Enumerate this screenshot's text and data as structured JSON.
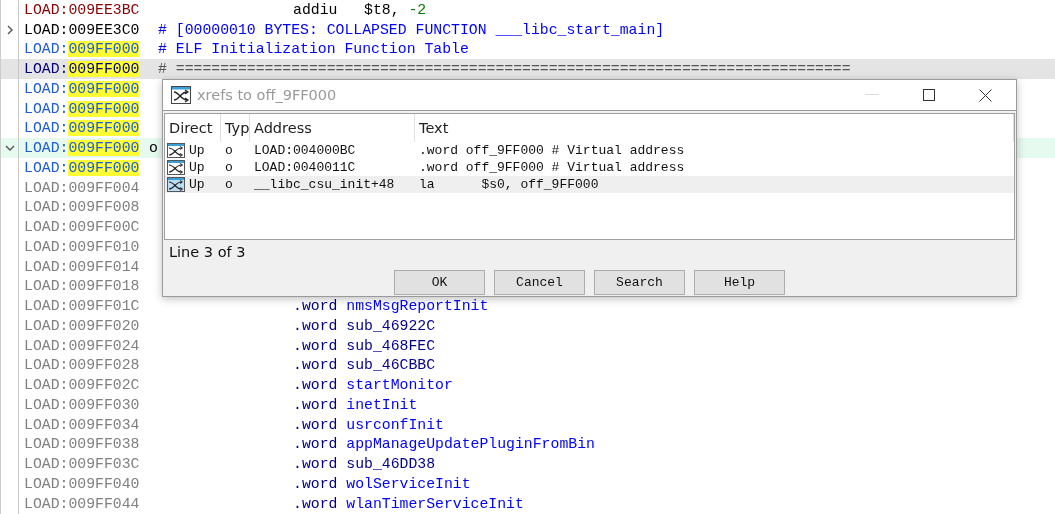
{
  "listing": {
    "rows": [
      {
        "kind": "code",
        "segment": "LOAD:",
        "offset": "009EE3BC",
        "highlighted": false,
        "selected": false,
        "current": false,
        "mnemonic": "addiu",
        "operand": "$t8, ",
        "number": "-2"
      },
      {
        "kind": "header",
        "segment": "LOAD:",
        "offset": "009EE3C0",
        "highlighted": false,
        "selected": false,
        "current": false,
        "expanded": false,
        "comment": "# [00000010 BYTES: COLLAPSED FUNCTION ___libc_start_main]"
      },
      {
        "kind": "data",
        "segment": "LOAD:",
        "offset": "009FF000",
        "highlighted": true,
        "selected": false,
        "current": false,
        "comment": "# ELF Initialization Function Table"
      },
      {
        "kind": "data",
        "segment": "LOAD:",
        "offset": "009FF000",
        "highlighted": true,
        "selected": true,
        "current": false,
        "rule": "# ============================================================================"
      },
      {
        "kind": "data",
        "segment": "LOAD:",
        "offset": "009FF000",
        "highlighted": true,
        "selected": false,
        "current": false
      },
      {
        "kind": "data",
        "segment": "LOAD:",
        "offset": "009FF000",
        "highlighted": true,
        "selected": false,
        "current": false
      },
      {
        "kind": "data",
        "segment": "LOAD:",
        "offset": "009FF000",
        "highlighted": true,
        "selected": false,
        "current": false
      },
      {
        "kind": "data",
        "segment": "LOAD:",
        "offset": "009FF000",
        "highlighted": true,
        "selected": false,
        "current": true,
        "expanded": true,
        "label": "o"
      },
      {
        "kind": "data",
        "segment": "LOAD:",
        "offset": "009FF000",
        "highlighted": true,
        "selected": false,
        "current": false
      },
      {
        "kind": "plain",
        "segment": "LOAD:",
        "offset": "009FF004",
        "highlighted": false,
        "selected": false,
        "current": false
      },
      {
        "kind": "plain",
        "segment": "LOAD:",
        "offset": "009FF008",
        "highlighted": false,
        "selected": false,
        "current": false
      },
      {
        "kind": "plain",
        "segment": "LOAD:",
        "offset": "009FF00C",
        "highlighted": false,
        "selected": false,
        "current": false
      },
      {
        "kind": "plain",
        "segment": "LOAD:",
        "offset": "009FF010",
        "highlighted": false,
        "selected": false,
        "current": false
      },
      {
        "kind": "plain",
        "segment": "LOAD:",
        "offset": "009FF014",
        "highlighted": false,
        "selected": false,
        "current": false
      },
      {
        "kind": "plain",
        "segment": "LOAD:",
        "offset": "009FF018",
        "highlighted": false,
        "selected": false,
        "current": false
      },
      {
        "kind": "plain",
        "segment": "LOAD:",
        "offset": "009FF01C",
        "highlighted": false,
        "selected": false,
        "current": false,
        "mnemonic": ".word",
        "operand": "nmsMsgReportInit",
        "color": "#0000ff"
      },
      {
        "kind": "plain",
        "segment": "LOAD:",
        "offset": "009FF020",
        "highlighted": false,
        "selected": false,
        "current": false,
        "mnemonic": ".word",
        "operand": "sub_46922C",
        "color": "#00008b"
      },
      {
        "kind": "plain",
        "segment": "LOAD:",
        "offset": "009FF024",
        "highlighted": false,
        "selected": false,
        "current": false,
        "mnemonic": ".word",
        "operand": "sub_468FEC",
        "color": "#00008b"
      },
      {
        "kind": "plain",
        "segment": "LOAD:",
        "offset": "009FF028",
        "highlighted": false,
        "selected": false,
        "current": false,
        "mnemonic": ".word",
        "operand": "sub_46CBBC",
        "color": "#00008b"
      },
      {
        "kind": "plain",
        "segment": "LOAD:",
        "offset": "009FF02C",
        "highlighted": false,
        "selected": false,
        "current": false,
        "mnemonic": ".word",
        "operand": "startMonitor",
        "color": "#0000ff"
      },
      {
        "kind": "plain",
        "segment": "LOAD:",
        "offset": "009FF030",
        "highlighted": false,
        "selected": false,
        "current": false,
        "mnemonic": ".word",
        "operand": "inetInit",
        "color": "#0000ff"
      },
      {
        "kind": "plain",
        "segment": "LOAD:",
        "offset": "009FF034",
        "highlighted": false,
        "selected": false,
        "current": false,
        "mnemonic": ".word",
        "operand": "usrconfInit",
        "color": "#0000ff"
      },
      {
        "kind": "plain",
        "segment": "LOAD:",
        "offset": "009FF038",
        "highlighted": false,
        "selected": false,
        "current": false,
        "mnemonic": ".word",
        "operand": "appManageUpdatePluginFromBin",
        "color": "#0000ff"
      },
      {
        "kind": "plain",
        "segment": "LOAD:",
        "offset": "009FF03C",
        "highlighted": false,
        "selected": false,
        "current": false,
        "mnemonic": ".word",
        "operand": "sub_46DD38",
        "color": "#00008b"
      },
      {
        "kind": "plain",
        "segment": "LOAD:",
        "offset": "009FF040",
        "highlighted": false,
        "selected": false,
        "current": false,
        "mnemonic": ".word",
        "operand": "wolServiceInit",
        "color": "#0000ff"
      },
      {
        "kind": "plain",
        "segment": "LOAD:",
        "offset": "009FF044",
        "highlighted": false,
        "selected": false,
        "current": false,
        "mnemonic": ".word",
        "operand": "wlanTimerServiceInit",
        "color": "#0000ff"
      }
    ]
  },
  "dialog": {
    "title": "xrefs to off_9FF000",
    "columns": [
      "Direct",
      "Typ",
      "Address",
      "Text"
    ],
    "rows": [
      {
        "direction": "Up",
        "type": "o",
        "address": "LOAD:004000BC",
        "text": ".word off_9FF000 # Virtual address",
        "selected": false
      },
      {
        "direction": "Up",
        "type": "o",
        "address": "LOAD:0040011C",
        "text": ".word off_9FF000 # Virtual address",
        "selected": false
      },
      {
        "direction": "Up",
        "type": "o",
        "address": "__libc_csu_init+48",
        "text": "la      $s0, off_9FF000",
        "selected": true
      }
    ],
    "status": "Line 3 of 3",
    "buttons": [
      "OK",
      "Cancel",
      "Search",
      "Help"
    ]
  }
}
